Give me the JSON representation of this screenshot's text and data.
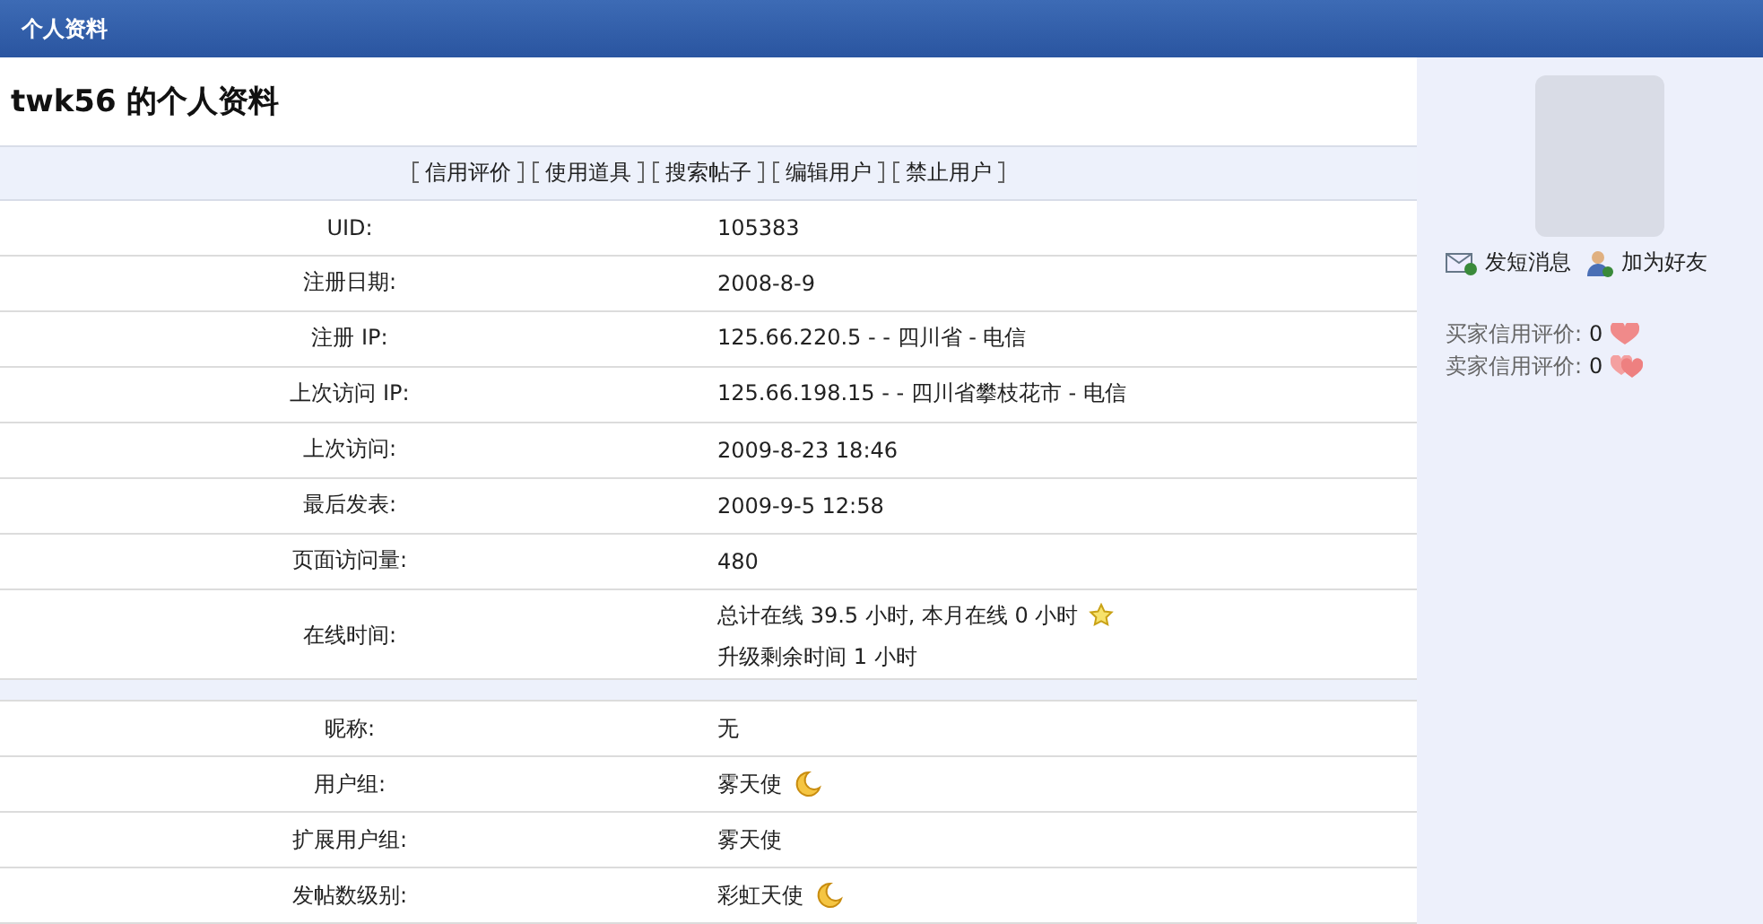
{
  "header": {
    "title": "个人资料"
  },
  "profile": {
    "heading": "twk56 的个人资料",
    "actions": [
      "信用评价",
      "使用道具",
      "搜索帖子",
      "编辑用户",
      "禁止用户"
    ],
    "sections": [
      {
        "rows": [
          {
            "label": "UID:",
            "value": [
              "105383"
            ],
            "kind": "plain"
          },
          {
            "label": "注册日期:",
            "value": [
              "2008-8-9"
            ],
            "kind": "plain"
          },
          {
            "label": "注册 IP:",
            "value": [
              "125.66.220.5 - - 四川省 - 电信"
            ],
            "kind": "plain"
          },
          {
            "label": "上次访问 IP:",
            "value": [
              "125.66.198.15 - - 四川省攀枝花市 - 电信"
            ],
            "kind": "plain"
          },
          {
            "label": "上次访问:",
            "value": [
              "2009-8-23 18:46"
            ],
            "kind": "plain"
          },
          {
            "label": "最后发表:",
            "value": [
              "2009-9-5 12:58"
            ],
            "kind": "plain"
          },
          {
            "label": "页面访问量:",
            "value": [
              "480"
            ],
            "kind": "plain"
          },
          {
            "label": "在线时间:",
            "value": [
              "总计在线 39.5 小时, 本月在线 0 小时",
              "升级剩余时间 1 小时"
            ],
            "kind": "star"
          }
        ]
      },
      {
        "rows": [
          {
            "label": "昵称:",
            "value": [
              "无"
            ],
            "kind": "plain"
          },
          {
            "label": "用户组:",
            "value": [
              "雾天使"
            ],
            "kind": "moon"
          },
          {
            "label": "扩展用户组:",
            "value": [
              "雾天使"
            ],
            "kind": "plain"
          },
          {
            "label": "发帖数级别:",
            "value": [
              "彩虹天使"
            ],
            "kind": "moon"
          }
        ]
      }
    ]
  },
  "sidebar": {
    "links": [
      {
        "label": "发短消息",
        "kind": "message"
      },
      {
        "label": "加为好友",
        "kind": "friend"
      }
    ],
    "ratings": [
      {
        "label": "买家信用评价:",
        "value": "0",
        "kind": "buyer"
      },
      {
        "label": "卖家信用评价:",
        "value": "0",
        "kind": "seller"
      }
    ]
  }
}
